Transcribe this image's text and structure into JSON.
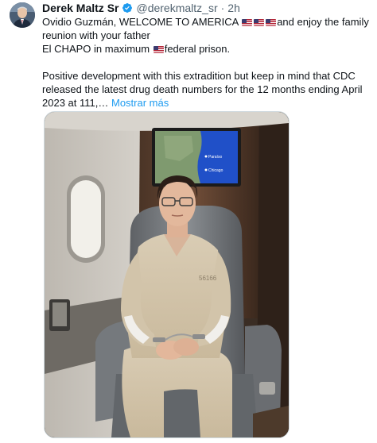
{
  "author": {
    "name": "Derek Maltz Sr",
    "handle": "@derekmaltz_sr",
    "separator": "·",
    "time": "2h"
  },
  "tweet": {
    "line1_a": "Ovidio Guzmán, WELCOME TO AMERICA ",
    "line1_b": "and enjoy the family",
    "line2": "reunion with your father",
    "line3_a": "El CHAPO in maximum ",
    "line3_b": "federal prison.",
    "line4": "Positive development with this extradition but keep in mind that CDC",
    "line5": "released the latest drug death numbers for the 12 months ending April",
    "line6": "2023 at 111,…",
    "show_more": "Mostrar más"
  },
  "media": {
    "screen_label_1": "Paraíso",
    "screen_label_2": "Chicago",
    "uniform_number": "56166"
  },
  "colors": {
    "link": "#1d9bf0",
    "verified": "#1d9bf0",
    "secondary_text": "#536471"
  },
  "icons": [
    "verified-badge-icon",
    "us-flag-icon"
  ]
}
